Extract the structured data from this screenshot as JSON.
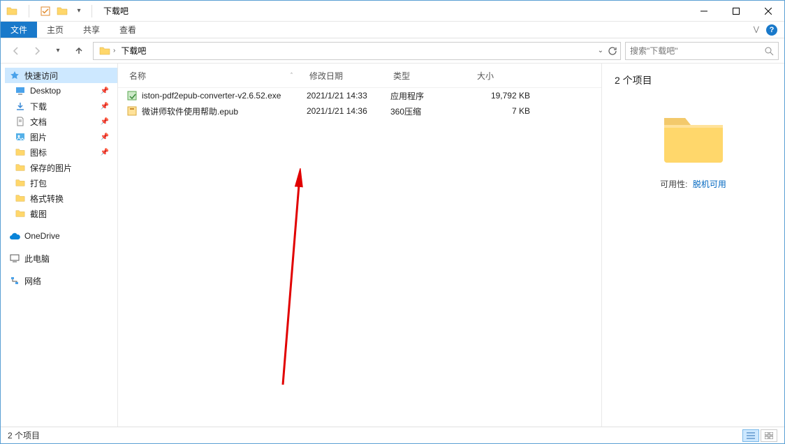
{
  "window": {
    "title": "下载吧"
  },
  "ribbon": {
    "file": "文件",
    "tabs": [
      "主页",
      "共享",
      "查看"
    ]
  },
  "address": {
    "location": "下载吧",
    "search_placeholder": "搜索\"下载吧\""
  },
  "sidebar": {
    "quick_access": "快速访问",
    "items": [
      {
        "label": "Desktop",
        "pinned": true
      },
      {
        "label": "下载",
        "pinned": true
      },
      {
        "label": "文档",
        "pinned": true
      },
      {
        "label": "图片",
        "pinned": true
      },
      {
        "label": "图标",
        "pinned": true
      },
      {
        "label": "保存的图片",
        "pinned": false
      },
      {
        "label": "打包",
        "pinned": false
      },
      {
        "label": "格式转换",
        "pinned": false
      },
      {
        "label": "截图",
        "pinned": false
      }
    ],
    "onedrive": "OneDrive",
    "this_pc": "此电脑",
    "network": "网络"
  },
  "columns": {
    "name": "名称",
    "date": "修改日期",
    "type": "类型",
    "size": "大小"
  },
  "files": [
    {
      "name": "iston-pdf2epub-converter-v2.6.52.exe",
      "date": "2021/1/21 14:33",
      "type": "应用程序",
      "size": "19,792 KB",
      "icon": "exe"
    },
    {
      "name": "微讲师软件使用帮助.epub",
      "date": "2021/1/21 14:36",
      "type": "360压缩",
      "size": "7 KB",
      "icon": "archive"
    }
  ],
  "preview": {
    "count_label": "2 个项目",
    "availability_label": "可用性:",
    "availability_value": "脱机可用"
  },
  "status": {
    "text": "2 个项目"
  }
}
